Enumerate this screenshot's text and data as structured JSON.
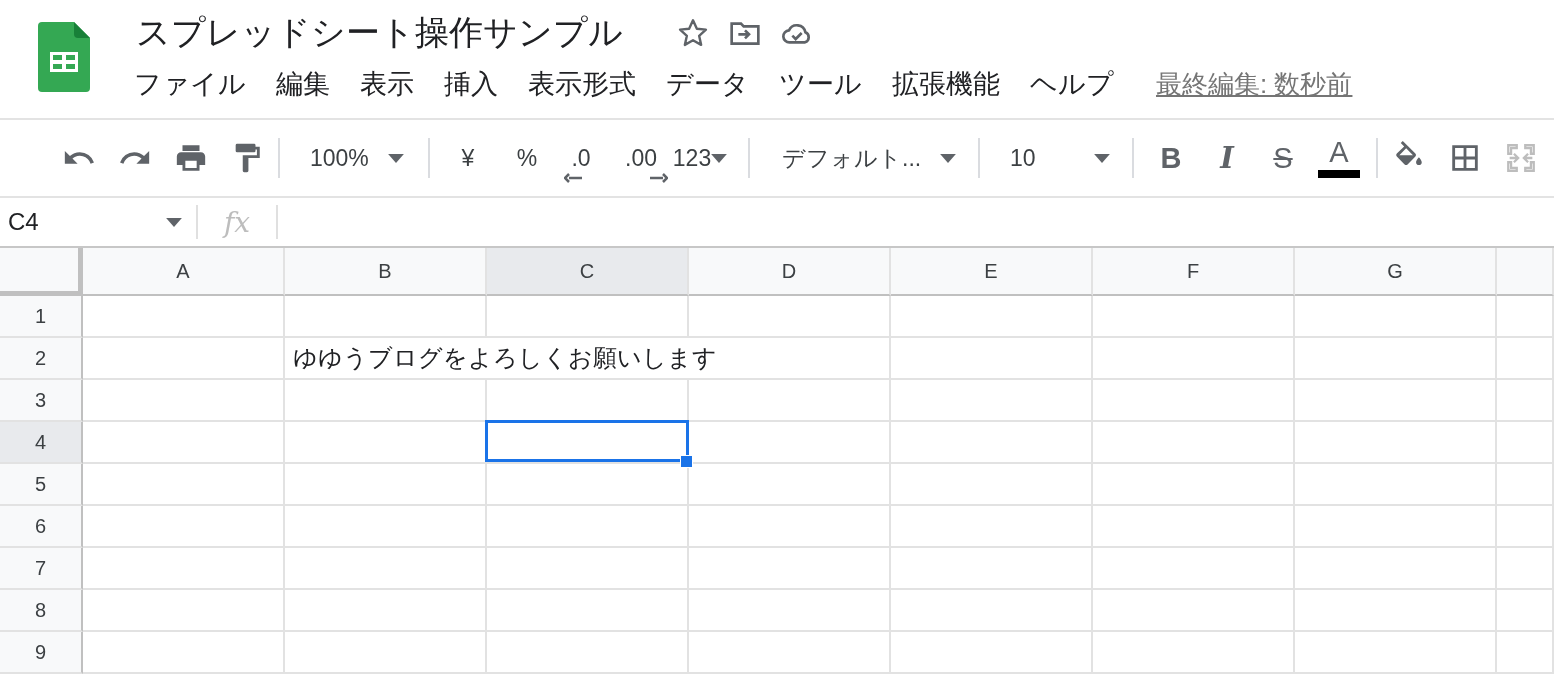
{
  "document": {
    "title": "スプレッドシート操作サンプル"
  },
  "menu": [
    {
      "label": "ファイル"
    },
    {
      "label": "編集"
    },
    {
      "label": "表示"
    },
    {
      "label": "挿入"
    },
    {
      "label": "表示形式"
    },
    {
      "label": "データ"
    },
    {
      "label": "ツール"
    },
    {
      "label": "拡張機能"
    },
    {
      "label": "ヘルプ"
    }
  ],
  "last_edit": "最終編集: 数秒前",
  "toolbar": {
    "zoom": "100%",
    "currency": "¥",
    "percent": "%",
    "decrease_decimal": ".0",
    "increase_decimal": ".00",
    "more_formats": "123",
    "font": "デフォルト...",
    "font_size": "10",
    "bold": "B",
    "italic": "I",
    "strikethrough": "S",
    "text_color": "A"
  },
  "name_box": "C4",
  "formula_icon": "fx",
  "columns": [
    {
      "label": "A",
      "selected": false
    },
    {
      "label": "B",
      "selected": false
    },
    {
      "label": "C",
      "selected": true
    },
    {
      "label": "D",
      "selected": false
    },
    {
      "label": "E",
      "selected": false
    },
    {
      "label": "F",
      "selected": false
    },
    {
      "label": "G",
      "selected": false
    }
  ],
  "rows": [
    {
      "label": "1",
      "selected": false
    },
    {
      "label": "2",
      "selected": false,
      "cells": {
        "B": "ゆゆうブログをよろしくお願いします"
      }
    },
    {
      "label": "3",
      "selected": false
    },
    {
      "label": "4",
      "selected": true
    },
    {
      "label": "5",
      "selected": false
    },
    {
      "label": "6",
      "selected": false
    },
    {
      "label": "7",
      "selected": false
    },
    {
      "label": "8",
      "selected": false
    },
    {
      "label": "9",
      "selected": false
    }
  ]
}
